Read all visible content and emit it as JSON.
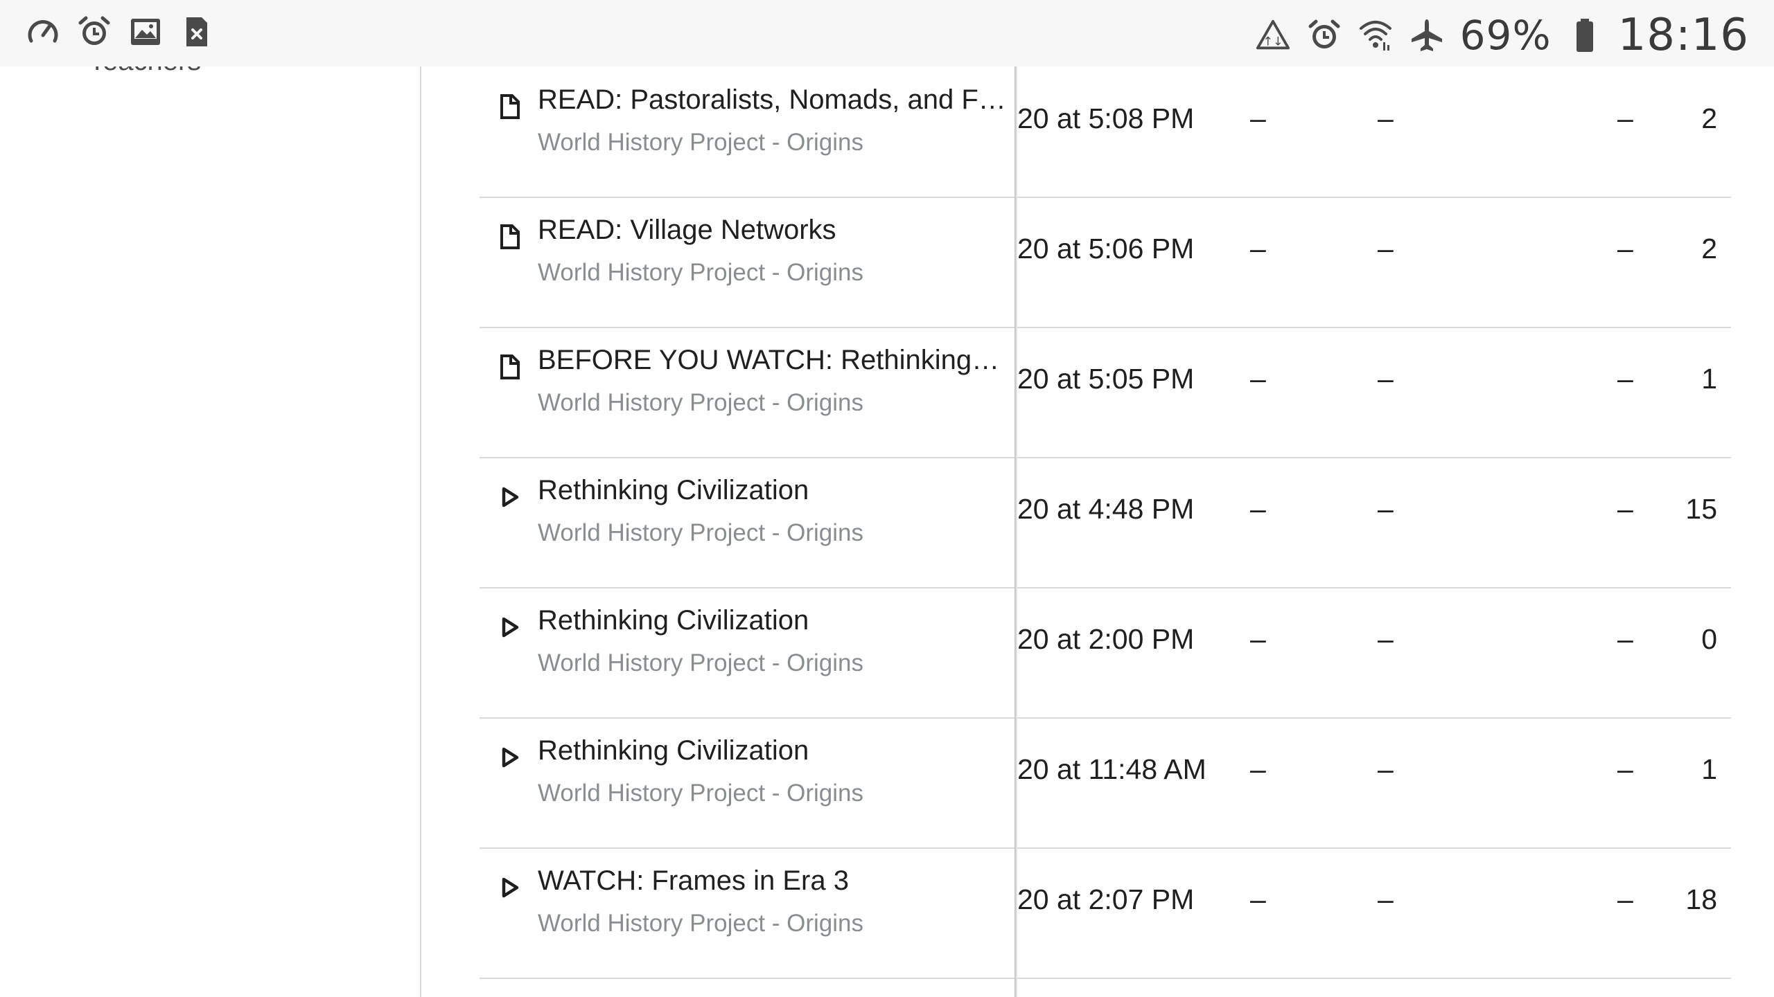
{
  "status_bar": {
    "left_icons": [
      "speedometer-icon",
      "alarm-icon",
      "image-icon",
      "close-file-icon"
    ],
    "right_icons": [
      "data-saver-icon",
      "alarm-icon",
      "wifi-icon",
      "airplane-mode-icon"
    ],
    "battery_percent": "69%",
    "time": "18:16"
  },
  "sidebar": {
    "partial_label": "Teachers"
  },
  "rows": [
    {
      "icon": "document-icon",
      "title": "READ: Pastoralists, Nomads, and F…",
      "subtitle": "World History Project - Origins",
      "date": "20 at 5:08 PM",
      "col1": "–",
      "col2": "–",
      "col3": "–",
      "count": "2"
    },
    {
      "icon": "document-icon",
      "title": "READ: Village Networks",
      "subtitle": "World History Project - Origins",
      "date": "20 at 5:06 PM",
      "col1": "–",
      "col2": "–",
      "col3": "–",
      "count": "2"
    },
    {
      "icon": "document-icon",
      "title": "BEFORE YOU WATCH: Rethinking…",
      "subtitle": "World History Project - Origins",
      "date": "20 at 5:05 PM",
      "col1": "–",
      "col2": "–",
      "col3": "–",
      "count": "1"
    },
    {
      "icon": "play-icon",
      "title": "Rethinking Civilization",
      "subtitle": "World History Project - Origins",
      "date": "20 at 4:48 PM",
      "col1": "–",
      "col2": "–",
      "col3": "–",
      "count": "15"
    },
    {
      "icon": "play-icon",
      "title": "Rethinking Civilization",
      "subtitle": "World History Project - Origins",
      "date": "20 at 2:00 PM",
      "col1": "–",
      "col2": "–",
      "col3": "–",
      "count": "0"
    },
    {
      "icon": "play-icon",
      "title": "Rethinking Civilization",
      "subtitle": "World History Project - Origins",
      "date": "20 at 11:48 AM",
      "col1": "–",
      "col2": "–",
      "col3": "–",
      "count": "1"
    },
    {
      "icon": "play-icon",
      "title": "WATCH: Frames in Era 3",
      "subtitle": "World History Project - Origins",
      "date": "20 at 2:07 PM",
      "col1": "–",
      "col2": "–",
      "col3": "–",
      "count": "18"
    }
  ]
}
